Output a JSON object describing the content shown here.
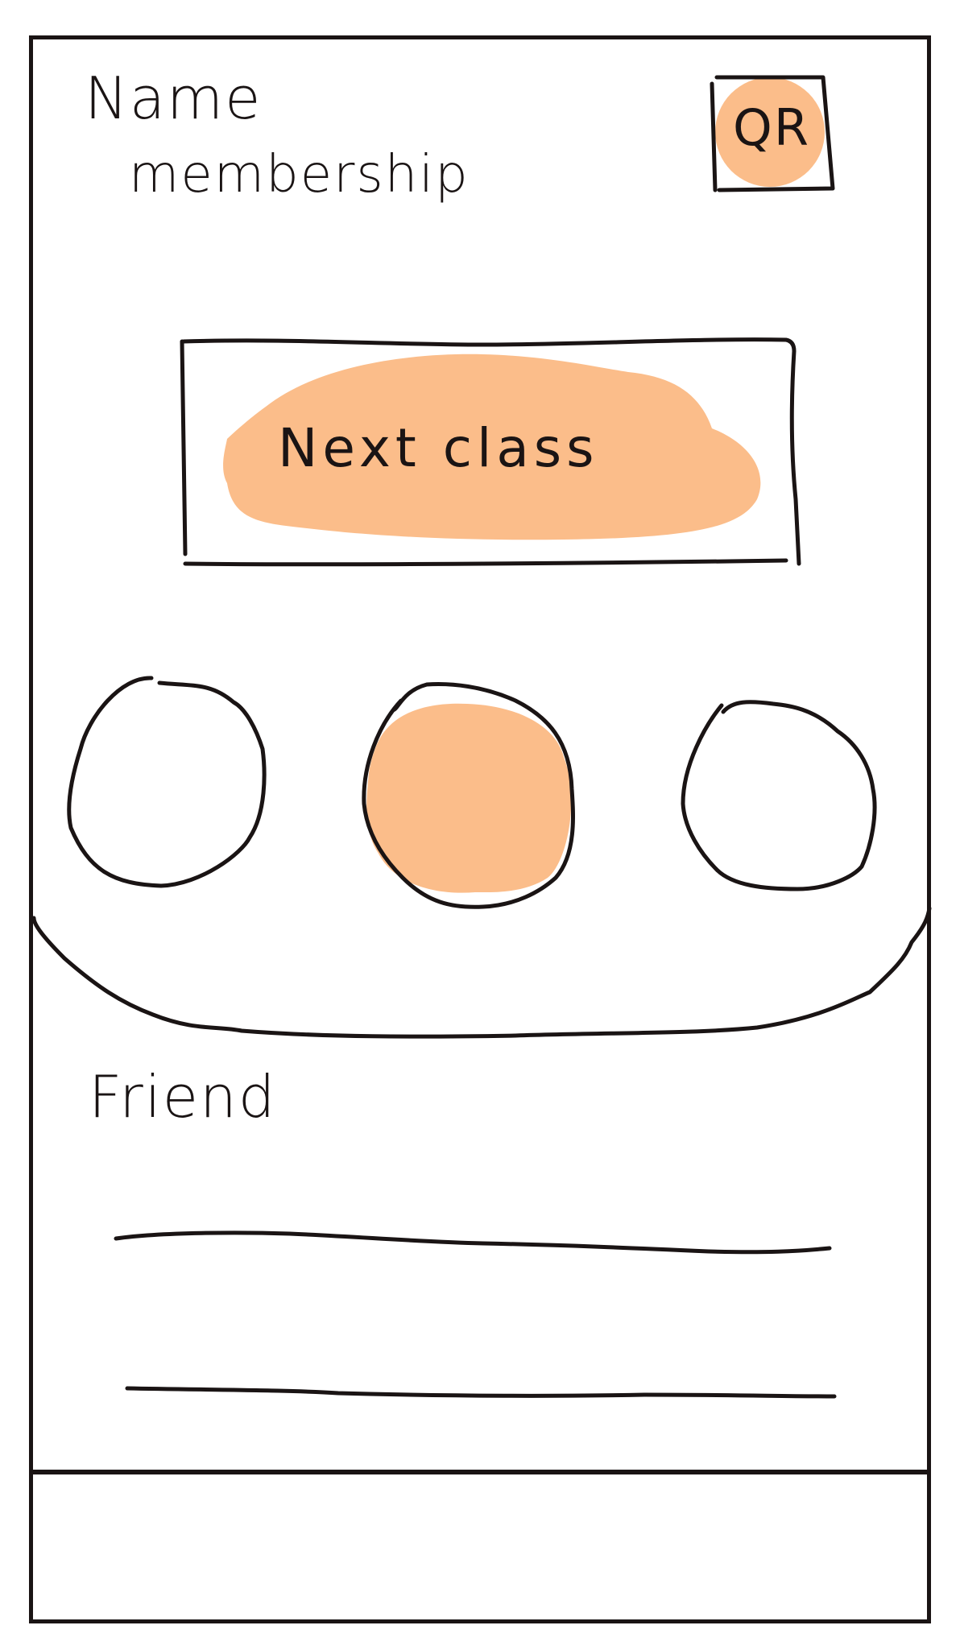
{
  "header": {
    "name": "Name",
    "membership": "membership"
  },
  "qr": {
    "label": "QR",
    "icon": "qr-code-icon"
  },
  "next_class": {
    "label": "Next class"
  },
  "tabs": [
    {
      "id": "tab-1",
      "selected": false
    },
    {
      "id": "tab-2",
      "selected": true
    },
    {
      "id": "tab-3",
      "selected": false
    }
  ],
  "friends": {
    "title": "Friend",
    "rows": [
      {
        "placeholder": ""
      },
      {
        "placeholder": ""
      }
    ]
  },
  "colors": {
    "accent": "#fbbd8a",
    "ink": "#1a1414",
    "background": "#ffffff"
  }
}
